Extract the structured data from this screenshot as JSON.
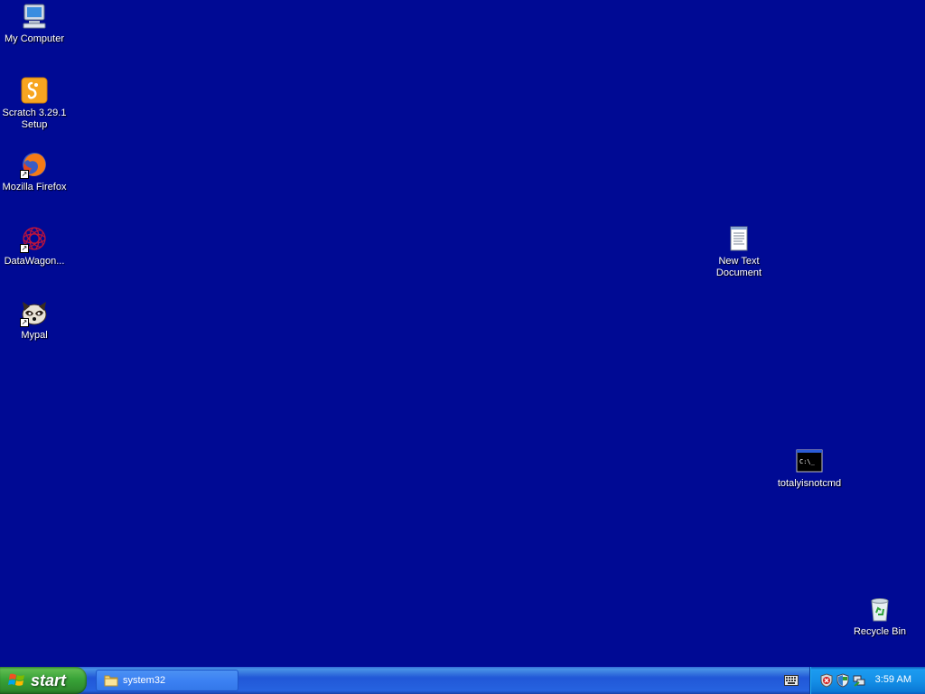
{
  "desktop": {
    "background_color": "#000a94",
    "icons": [
      {
        "label": "My Computer",
        "icon": "my-computer-icon"
      },
      {
        "label": "Scratch 3.29.1\nSetup",
        "icon": "scratch-icon"
      },
      {
        "label": "Mozilla Firefox",
        "icon": "firefox-icon"
      },
      {
        "label": "DataWagon...",
        "icon": "datawagon-icon"
      },
      {
        "label": "Mypal",
        "icon": "mypal-icon"
      },
      {
        "label": "New Text\nDocument",
        "icon": "text-document-icon"
      },
      {
        "label": "totalyisnotcmd",
        "icon": "cmd-icon"
      },
      {
        "label": "Recycle Bin",
        "icon": "recycle-bin-icon"
      }
    ]
  },
  "taskbar": {
    "start_label": "start",
    "tasks": [
      {
        "label": "system32",
        "icon": "folder-icon"
      }
    ],
    "tray": {
      "icons": [
        "keyboard-icon",
        "security-alert-icon",
        "shield-icon",
        "network-icon"
      ],
      "clock": "3:59 AM"
    }
  }
}
